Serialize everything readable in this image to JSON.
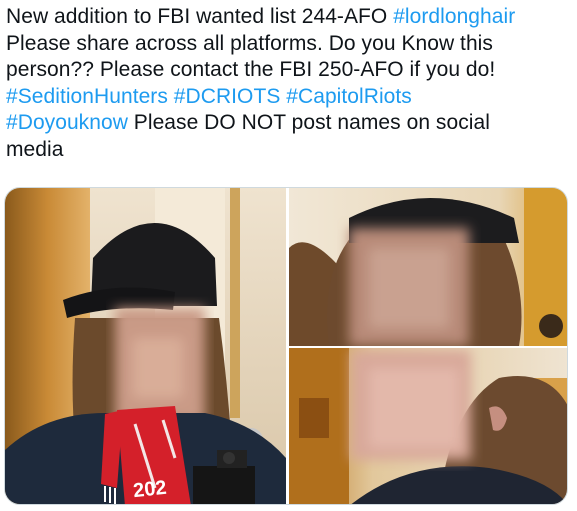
{
  "tweet": {
    "lines": [
      [
        {
          "type": "text",
          "value": "New addition to FBI wanted list 244-AFO "
        },
        {
          "type": "hashtag",
          "value": "#lordlonghair"
        }
      ],
      [
        {
          "type": "text",
          "value": "Please share across all platforms. Do you Know this"
        }
      ],
      [
        {
          "type": "text",
          "value": "person?? Please contact the FBI 250-AFO if you do!"
        }
      ],
      [
        {
          "type": "hashtag",
          "value": "#SeditionHunters"
        },
        {
          "type": "text",
          "value": " "
        },
        {
          "type": "hashtag",
          "value": "#DCRIOTS"
        },
        {
          "type": "text",
          "value": " "
        },
        {
          "type": "hashtag",
          "value": "#CapitolRiots"
        }
      ],
      [
        {
          "type": "hashtag",
          "value": "#Doyouknow"
        },
        {
          "type": "text",
          "value": " Please DO NOT post names on social"
        }
      ],
      [
        {
          "type": "text",
          "value": "media"
        }
      ]
    ]
  },
  "media": {
    "photos": [
      {
        "name": "photo-main",
        "description_icon": "photo",
        "scarf_text": "202"
      },
      {
        "name": "photo-top-right",
        "description_icon": "photo"
      },
      {
        "name": "photo-bottom-right",
        "description_icon": "photo"
      }
    ]
  },
  "colors": {
    "text": "#0f1419",
    "hashtag": "#1d9bf0",
    "border": "#cfd9de"
  }
}
